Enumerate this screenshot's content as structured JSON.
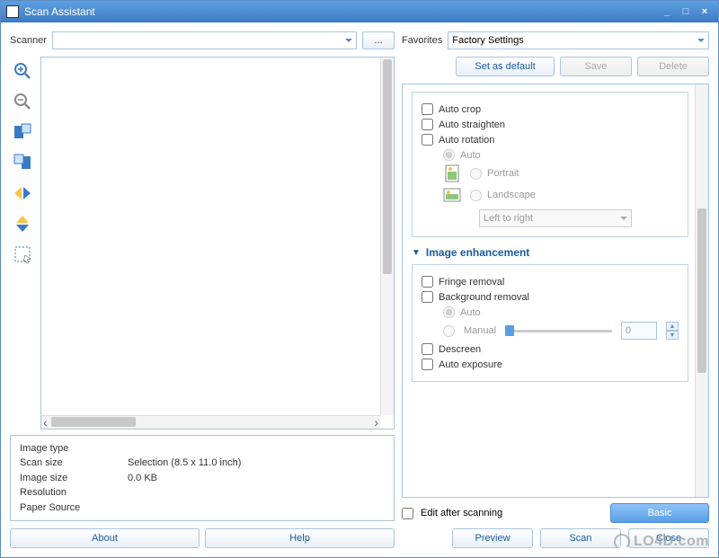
{
  "window": {
    "title": "Scan Assistant",
    "minimize": "_",
    "maximize": "□",
    "close": "×"
  },
  "scanner": {
    "label": "Scanner",
    "value": "",
    "browse": "..."
  },
  "favorites": {
    "label": "Favorites",
    "value": "Factory Settings",
    "set_default": "Set as default",
    "save": "Save",
    "delete": "Delete"
  },
  "auto": {
    "crop": "Auto crop",
    "straighten": "Auto straighten",
    "rotation": "Auto rotation",
    "auto": "Auto",
    "portrait": "Portrait",
    "landscape": "Landscape",
    "direction": "Left to right"
  },
  "enhancement": {
    "header": "Image enhancement",
    "fringe": "Fringe removal",
    "background": "Background removal",
    "auto": "Auto",
    "manual": "Manual",
    "manual_value": "0",
    "descreen": "Descreen",
    "exposure": "Auto exposure"
  },
  "bottom": {
    "edit": "Edit after scanning",
    "basic": "Basic",
    "preview": "Preview",
    "scan": "Scan",
    "close": "Close"
  },
  "info": {
    "image_type_label": "Image type",
    "image_type_value": "",
    "scan_size_label": "Scan size",
    "scan_size_value": "Selection (8.5 x 11.0 inch)",
    "image_size_label": "Image size",
    "image_size_value": "0.0 KB",
    "resolution_label": "Resolution",
    "resolution_value": "",
    "paper_source_label": "Paper Source",
    "paper_source_value": ""
  },
  "buttons": {
    "about": "About",
    "help": "Help"
  },
  "watermark": "LO4D.com"
}
